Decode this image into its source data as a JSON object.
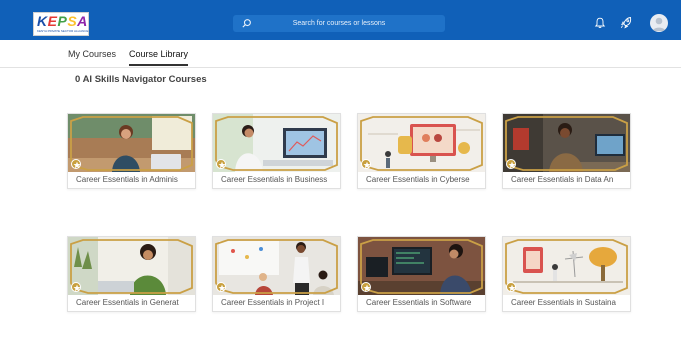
{
  "header": {
    "logo_text": "KEPSA",
    "logo_subtitle": "KENYA PRIVATE SECTOR ALLIANCE",
    "search_placeholder": "Search for courses or lessons"
  },
  "tabs": [
    {
      "label": "My Courses",
      "active": false
    },
    {
      "label": "Course Library",
      "active": true
    }
  ],
  "section_heading": "0 AI Skills Navigator Courses",
  "courses": [
    {
      "title": "Career Essentials in Adminis"
    },
    {
      "title": "Career Essentials in Business"
    },
    {
      "title": "Career Essentials in Cyberse"
    },
    {
      "title": "Career Essentials in Data An"
    },
    {
      "title": "Career Essentials in Generat"
    },
    {
      "title": "Career Essentials in Project I"
    },
    {
      "title": "Career Essentials in Software"
    },
    {
      "title": "Career Essentials in Sustaina"
    }
  ],
  "colors": {
    "header_bg": "#1060b8",
    "accent_gold": "#c8a03e"
  },
  "icons": [
    "search-icon",
    "bell-icon",
    "rocket-icon",
    "avatar",
    "star-icon"
  ]
}
